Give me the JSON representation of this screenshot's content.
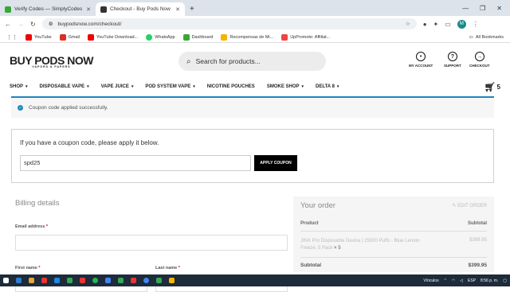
{
  "browser": {
    "tabs": [
      {
        "title": "Verify Codes — SimplyCodes",
        "active": false,
        "favicon_color": "#3aa636"
      },
      {
        "title": "Checkout - Buy Pods Now",
        "active": true,
        "favicon_color": "#333333"
      }
    ],
    "new_tab": "+",
    "url": "buypodsnow.com/checkout/",
    "profile_initial": "M",
    "bookmarks": [
      {
        "label": "YouTube",
        "color": "#e00"
      },
      {
        "label": "Gmail",
        "color": "#d93025"
      },
      {
        "label": "YouTube Download...",
        "color": "#e00"
      },
      {
        "label": "WhatsApp",
        "color": "#25d366"
      },
      {
        "label": "Dashboard",
        "color": "#3aa636"
      },
      {
        "label": "Recompensas de Mi...",
        "color": "#f4b400"
      },
      {
        "label": "UpPromote: Affiliat...",
        "color": "#e44"
      }
    ],
    "all_bookmarks": "All Bookmarks"
  },
  "site": {
    "logo": "BUY PODS NOW",
    "logo_tag": "VAPORS & PAPERS",
    "search_placeholder": "Search for products...",
    "account": "MY ACCOUNT",
    "support": "SUPPORT",
    "checkout": "CHECKOUT",
    "nav": [
      "SHOP",
      "DISPOSABLE VAPE",
      "VAPE JUICE",
      "POD SYSTEM VAPE",
      "NICOTINE POUCHES",
      "SMOKE SHOP",
      "DELTA 8"
    ],
    "nav_has_chevron": [
      true,
      true,
      true,
      true,
      false,
      true,
      true
    ],
    "cart_count": "5"
  },
  "notice": "Coupon code applied successfully.",
  "coupon": {
    "prompt": "If you have a coupon code, please apply it below.",
    "value": "spd25",
    "button": "APPLY COUPON"
  },
  "billing": {
    "title": "Billing details",
    "email_label": "Email address",
    "first_name_label": "First name",
    "last_name_label": "Last name",
    "required_mark": "*"
  },
  "order": {
    "title": "Your order",
    "edit": "EDIT ORDER",
    "col_product": "Product",
    "col_subtotal": "Subtotal",
    "item_name": "JINX Pro Disposable Device | 25000 Puffs - Blue Lemon Freeze, 5 Pack",
    "item_qty": "× 5",
    "item_price": "$399.95",
    "subtotal_label": "Subtotal",
    "subtotal_value": "$399.95"
  },
  "taskbar": {
    "icon_colors": [
      "#ffffff",
      "#2d7dd2",
      "#e8a33d",
      "#e33",
      "#1e88e5",
      "#34a853",
      "#e33",
      "#1db954",
      "#4285f4",
      "#34a853",
      "#e33",
      "#4285f4",
      "#34a853",
      "#ffb300"
    ],
    "tray_label": "Vínculos",
    "language": "ESP",
    "time": "8:56 p. m."
  }
}
